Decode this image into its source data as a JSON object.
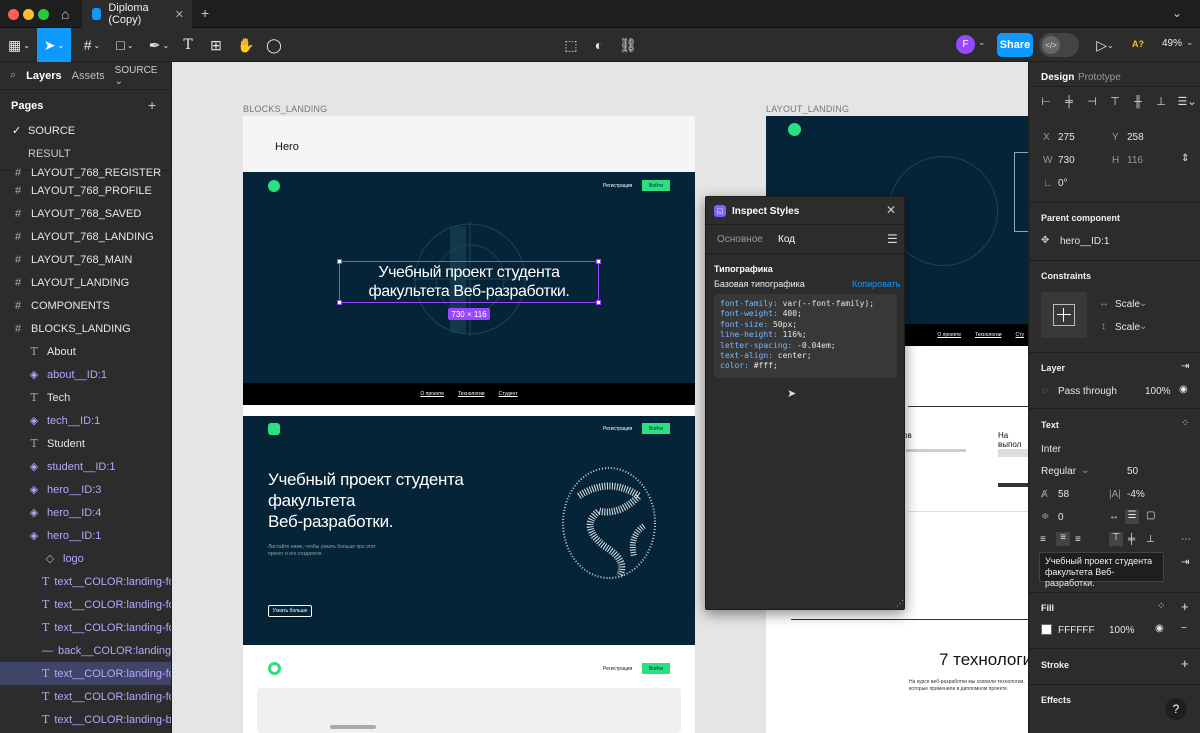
{
  "titlebar": {
    "file_tab": "Diploma (Copy)",
    "new_tab": "+",
    "home": "⌂"
  },
  "toolbar": {
    "share": "Share",
    "avatar": "F",
    "zoom": "49%",
    "aa": "A?"
  },
  "left_panel": {
    "tabs": {
      "layers": "Layers",
      "assets": "Assets",
      "page_select": "SOURCE ⌄"
    },
    "pages_label": "Pages",
    "pages": [
      "SOURCE",
      "RESULT"
    ],
    "layers": [
      {
        "label": "LAYOUT_768_REGISTER",
        "type": "frame"
      },
      {
        "label": "LAYOUT_768_PROFILE",
        "type": "frame"
      },
      {
        "label": "LAYOUT_768_SAVED",
        "type": "frame"
      },
      {
        "label": "LAYOUT_768_LANDING",
        "type": "frame"
      },
      {
        "label": "LAYOUT_768_MAIN",
        "type": "frame"
      },
      {
        "label": "LAYOUT_LANDING",
        "type": "frame"
      },
      {
        "label": "COMPONENTS",
        "type": "frame"
      },
      {
        "label": "BLOCKS_LANDING",
        "type": "frame"
      },
      {
        "label": "About",
        "type": "text"
      },
      {
        "label": "about__ID:1",
        "type": "instance"
      },
      {
        "label": "Tech",
        "type": "text"
      },
      {
        "label": "tech__ID:1",
        "type": "instance"
      },
      {
        "label": "Student",
        "type": "text"
      },
      {
        "label": "student__ID:1",
        "type": "instance"
      },
      {
        "label": "hero__ID:3",
        "type": "instance"
      },
      {
        "label": "hero__ID:4",
        "type": "instance"
      },
      {
        "label": "hero__ID:1",
        "type": "instance"
      },
      {
        "label": "logo",
        "type": "component-child"
      },
      {
        "label": "text__COLOR:landing-fon...",
        "type": "text-child"
      },
      {
        "label": "text__COLOR:landing-fon...",
        "type": "text-child"
      },
      {
        "label": "text__COLOR:landing-fon...",
        "type": "text-child"
      },
      {
        "label": "back__COLOR:landing-1",
        "type": "line-child"
      },
      {
        "label": "text__COLOR:landing-fon...",
        "type": "text-child"
      },
      {
        "label": "text__COLOR:landing-fon...",
        "type": "text-child"
      },
      {
        "label": "text__COLOR:landing-but...",
        "type": "text-child"
      }
    ]
  },
  "canvas": {
    "blocks_label": "BLOCKS_LANDING",
    "layout_label": "LAYOUT_LANDING",
    "hero_label": "Hero",
    "hero_title_l1": "Учебный проект студента",
    "hero_title_l2": "факультета Веб-разработки.",
    "size_badge": "730 × 116",
    "nav_register": "Регистрация",
    "nav_login": "Войти",
    "footer_links": [
      "О проекте",
      "Технологии",
      "Студент"
    ],
    "hero2_title_l1": "Учебный проект студента",
    "hero2_title_l2": "факультета",
    "hero2_title_l3": "Веб-разработки.",
    "hero2_sub": "Листайте ниже, чтобы узнать больше про этот проект и его создателя.",
    "hero2_btn": "Узнать больше",
    "right_nav": [
      "О проекте",
      "Технологии",
      "Сту"
    ],
    "right_tech_title": "7 технологи",
    "right_tech_sub": "На курсе веб-разработки мы освоили технологии, которые применили в дипломном проекте.",
    "right_col2_title": "На выпол",
    "right_col1_title": "ов"
  },
  "inspect": {
    "title": "Inspect Styles",
    "tabs": [
      "Основное",
      "Код"
    ],
    "section": "Типографика",
    "subsection": "Базовая типографика",
    "copy": "Копировать",
    "code": [
      {
        "prop": "font-family:",
        "val": " var(--font-family);"
      },
      {
        "prop": "font-weight:",
        "val": " 400;"
      },
      {
        "prop": "font-size:",
        "val": " 50px;"
      },
      {
        "prop": "line-height:",
        "val": " 116%;"
      },
      {
        "prop": "letter-spacing:",
        "val": " -0.04em;"
      },
      {
        "prop": "text-align:",
        "val": " center;"
      },
      {
        "prop": "color:",
        "val": " #fff;"
      }
    ]
  },
  "right_panel": {
    "tabs": [
      "Design",
      "Prototype"
    ],
    "x_label": "X",
    "x": "275",
    "y_label": "Y",
    "y": "258",
    "w_label": "W",
    "w": "730",
    "h_label": "H",
    "h": "116",
    "rotation": "0°",
    "parent_title": "Parent component",
    "parent_name": "hero__ID:1",
    "constraints_title": "Constraints",
    "constraint_h": "Scale",
    "constraint_v": "Scale",
    "layer_title": "Layer",
    "blend": "Pass through",
    "opacity": "100%",
    "text_title": "Text",
    "font": "Inter",
    "weight": "Regular",
    "size": "50",
    "line_height": "58",
    "letter_spacing": "-4%",
    "paragraph": "0",
    "preview_l1": "Учебный проект студента",
    "preview_l2": "факультета Веб-разработки.",
    "fill_title": "Fill",
    "fill_hex": "FFFFFF",
    "fill_opacity": "100%",
    "stroke_title": "Stroke",
    "effects_title": "Effects",
    "help": "?"
  },
  "colors": {
    "accent": "#0d99ff",
    "landing_dark": "#052437",
    "landing_green": "#2be080",
    "component": "#b8a5ff"
  }
}
